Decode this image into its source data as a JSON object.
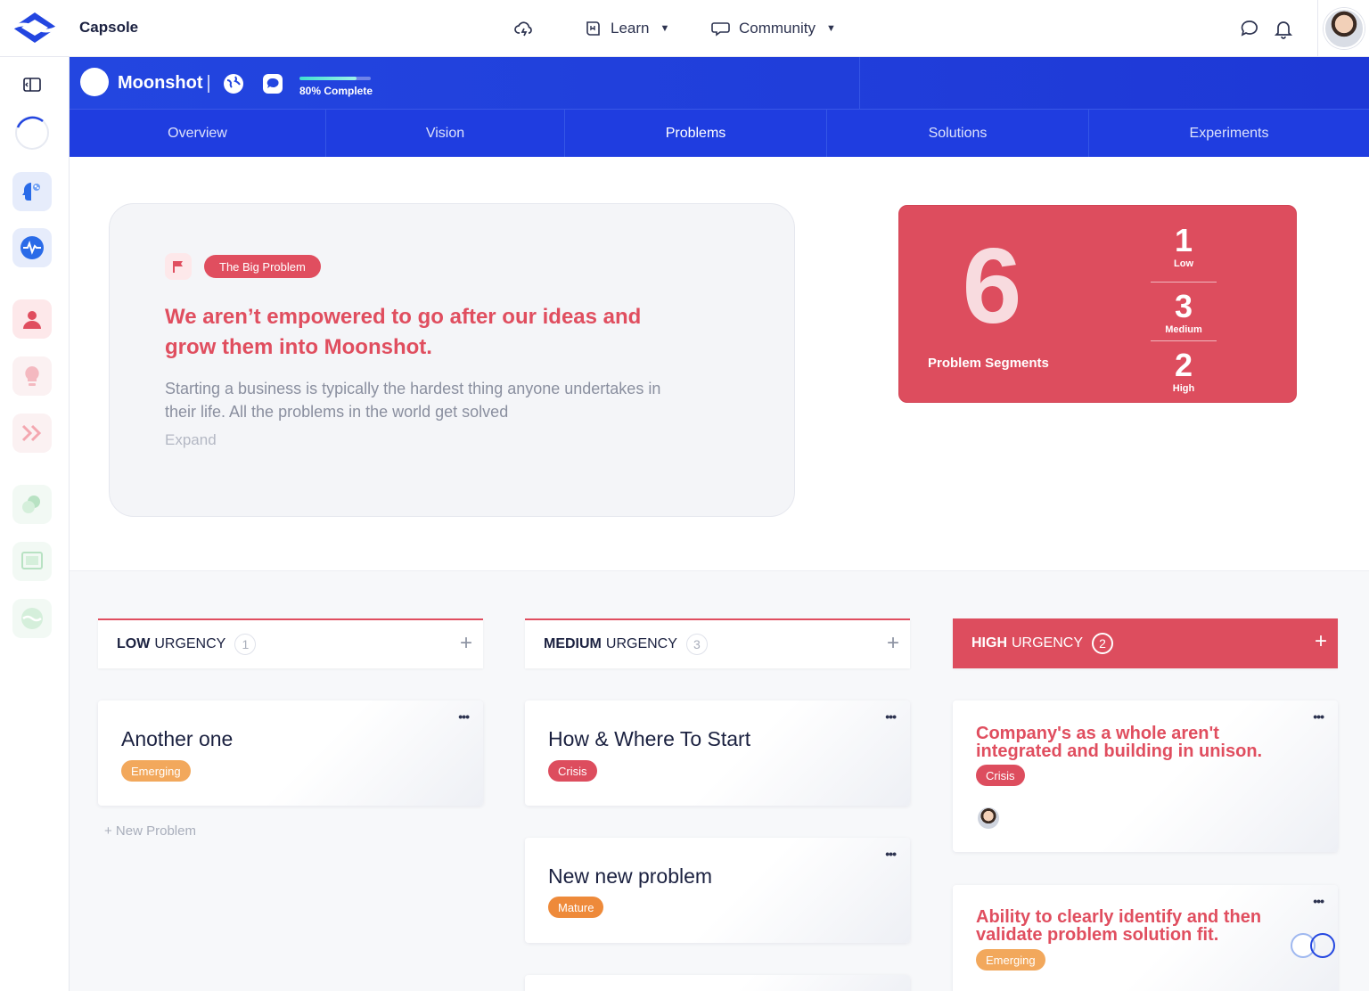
{
  "app": {
    "title": "Capsole"
  },
  "topnav": {
    "learn_label": "Learn",
    "community_label": "Community"
  },
  "project": {
    "name": "Moonshot",
    "progress_percent": 80,
    "progress_label": "80% Complete"
  },
  "tabs": [
    {
      "label": "Overview",
      "active": false
    },
    {
      "label": "Vision",
      "active": false
    },
    {
      "label": "Problems",
      "active": true
    },
    {
      "label": "Solutions",
      "active": false
    },
    {
      "label": "Experiments",
      "active": false
    }
  ],
  "big_problem": {
    "badge": "The Big Problem",
    "title": "We aren’t empowered to go after our ideas and grow them into Moonshot.",
    "description": "Starting a business is typically the hardest thing anyone undertakes in their life. All the problems in the world get solved",
    "expand_label": "Expand"
  },
  "stats": {
    "total": "6",
    "total_label": "Problem Segments",
    "low": {
      "value": "1",
      "label": "Low"
    },
    "medium": {
      "value": "3",
      "label": "Medium"
    },
    "high": {
      "value": "2",
      "label": "High"
    }
  },
  "columns": {
    "low": {
      "strong": "LOW",
      "rest": "URGENCY",
      "count": "1",
      "plus": "+"
    },
    "medium": {
      "strong": "MEDIUM",
      "rest": "URGENCY",
      "count": "3",
      "plus": "+"
    },
    "high": {
      "strong": "HIGH",
      "rest": "URGENCY",
      "count": "2",
      "plus": "+"
    }
  },
  "cards": {
    "low_1": {
      "title": "Another one",
      "tag": "Emerging"
    },
    "medium_1": {
      "title": "How & Where To Start",
      "tag": "Crisis"
    },
    "medium_2": {
      "title": "New new problem",
      "tag": "Mature"
    },
    "high_1": {
      "title": "Company's as a whole aren't integrated and building in unison.",
      "tag": "Crisis"
    },
    "high_2": {
      "title": "Ability to clearly identify and then validate problem solution fit.",
      "tag": "Emerging"
    },
    "more_label": "•••"
  },
  "new_problem_label": "+ New Problem",
  "colors": {
    "brand_blue": "#2346e0",
    "accent_red": "#dd4d5e",
    "emerging": "#f2a85c",
    "mature": "#ee8a3a"
  }
}
